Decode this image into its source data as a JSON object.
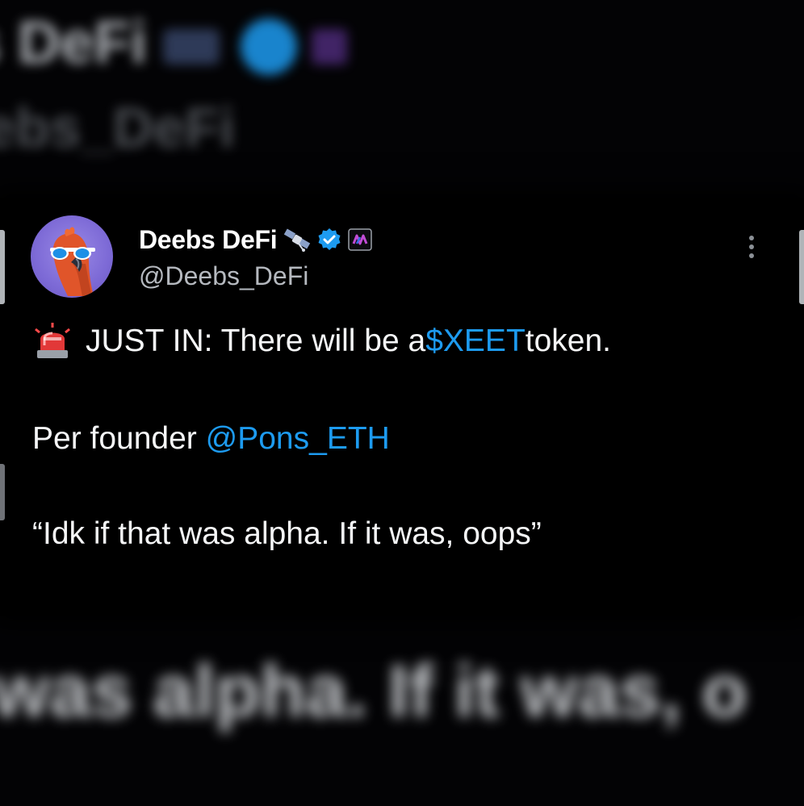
{
  "background": {
    "blur_top_line1": "s DeFi",
    "blur_top_line2": "ebs_DeFi",
    "blur_bottom": "was alpha. If it was, o"
  },
  "author": {
    "display_name": "Deebs DeFi",
    "handle": "@Deebs_DeFi"
  },
  "tweet": {
    "line1_prefix": "JUST IN: There will be a ",
    "cashtag": "$XEET",
    "line1_suffix": " token.",
    "line2_prefix": "Per founder ",
    "mention": "@Pons_ETH",
    "line3": "“Idk if that was alpha. If it was, oops”"
  },
  "icons": {
    "siren": "police-light-emoji-icon",
    "satellite": "satellite-emoji-icon",
    "verified": "verified-badge-icon",
    "affiliate": "affiliate-logo-icon",
    "more": "more-options-icon"
  },
  "colors": {
    "link": "#1d9bf0",
    "background": "#000000",
    "verified": "#1d9bf0"
  }
}
